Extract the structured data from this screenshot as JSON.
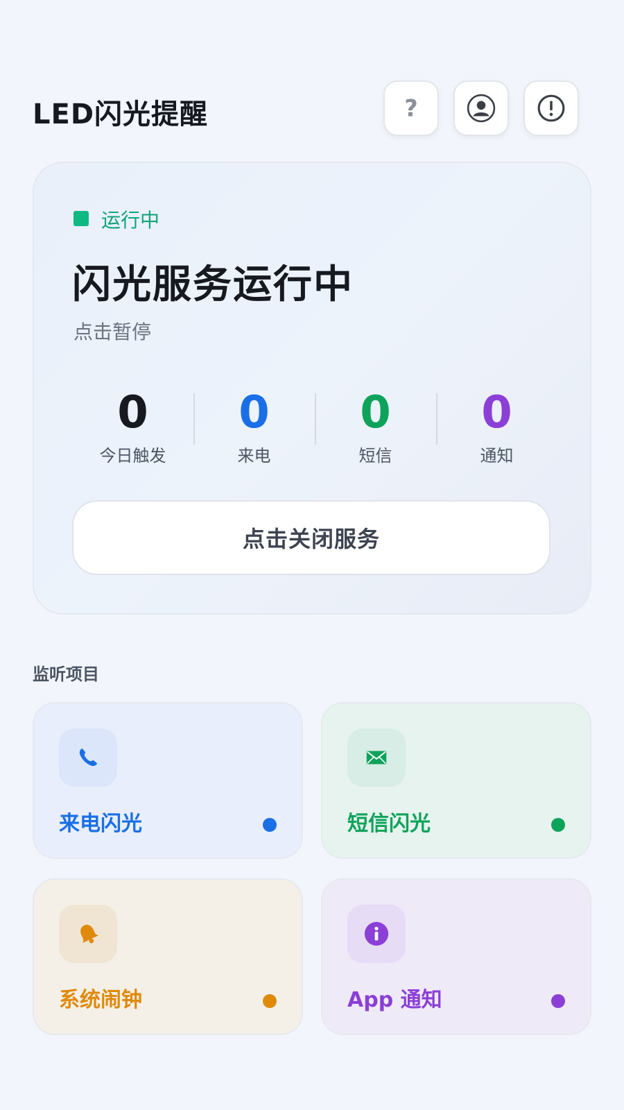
{
  "header": {
    "title": "LED闪光提醒",
    "help_icon": "question-icon",
    "account_icon": "user-icon",
    "info_icon": "alert-circle-icon"
  },
  "status_card": {
    "status_label": "运行中",
    "title": "闪光服务运行中",
    "subtitle": "点击暂停",
    "stats": [
      {
        "value": "0",
        "label": "今日触发",
        "color": "#16191f"
      },
      {
        "value": "0",
        "label": "来电",
        "color": "#1a6fe6"
      },
      {
        "value": "0",
        "label": "短信",
        "color": "#0ea35a"
      },
      {
        "value": "0",
        "label": "通知",
        "color": "#8b3fd6"
      }
    ],
    "close_button_label": "点击关闭服务",
    "status_color": "#10b981"
  },
  "monitor": {
    "section_title": "监听项目",
    "items": [
      {
        "label": "来电闪光",
        "icon": "phone-icon",
        "color": "#1a6fe6"
      },
      {
        "label": "短信闪光",
        "icon": "mail-icon",
        "color": "#0ea35a"
      },
      {
        "label": "系统闹钟",
        "icon": "bell-icon",
        "color": "#e08a0b"
      },
      {
        "label": "App 通知",
        "icon": "info-icon",
        "color": "#8b3fd6"
      }
    ]
  }
}
